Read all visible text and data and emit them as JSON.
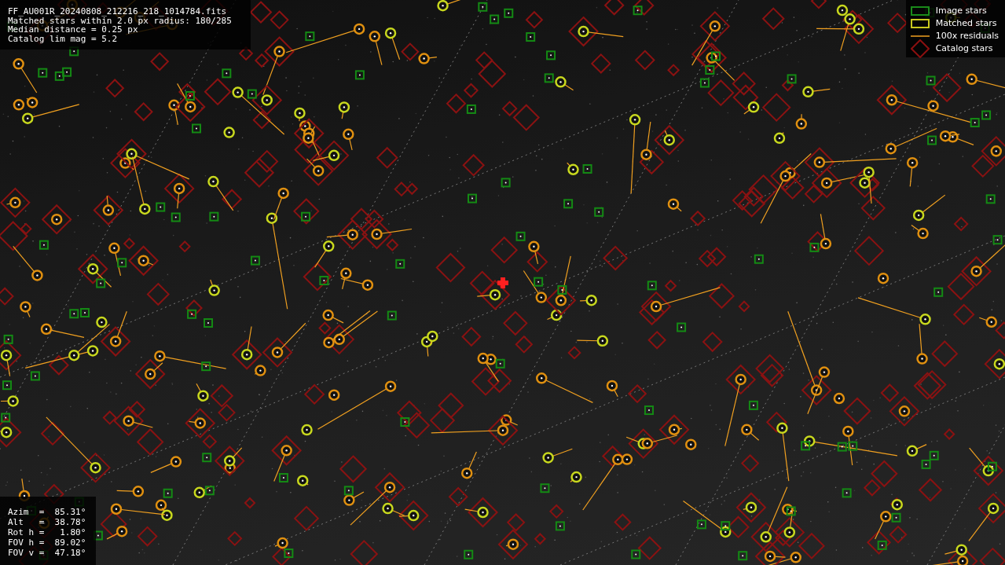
{
  "header": {
    "lines": [
      "FF_AU001R_20240808_212216_218_1014784.fits",
      "Matched stars within 2.0 px radius: 180/285",
      "Median distance = 0.25 px",
      "Catalog lim mag = 5.2"
    ]
  },
  "legend": [
    {
      "kind": "image",
      "label": "Image stars"
    },
    {
      "kind": "matched",
      "label": "Matched stars"
    },
    {
      "kind": "residual",
      "label": "100x residuals"
    },
    {
      "kind": "catalog",
      "label": "Catalog stars"
    }
  ],
  "pointing": {
    "lines": [
      "Azim  =  85.31°",
      "Alt   =  38.78°",
      "Rot h =   1.80°",
      "FOV h =  89.02°",
      "FOV v =  47.18°"
    ]
  }
}
